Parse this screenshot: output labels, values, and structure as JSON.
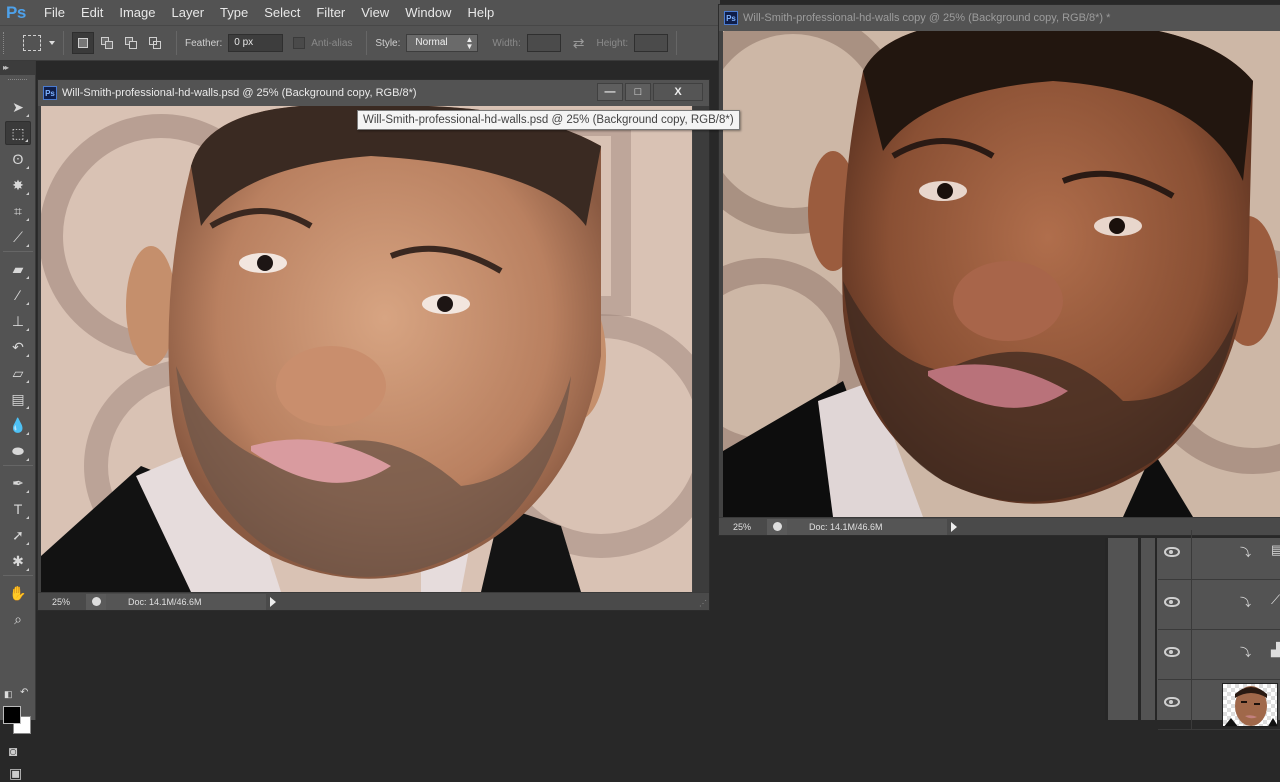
{
  "app": {
    "logo": "Ps",
    "brand_color": "#4ea1ea"
  },
  "menu": [
    "File",
    "Edit",
    "Image",
    "Layer",
    "Type",
    "Select",
    "Filter",
    "View",
    "Window",
    "Help"
  ],
  "options_bar": {
    "tool_icon": "rectangular-marquee-icon",
    "selection_modes": [
      "new-selection",
      "add-to-selection",
      "subtract-from-selection",
      "intersect-with-selection"
    ],
    "active_mode": "new-selection",
    "feather_label": "Feather:",
    "feather_value": "0 px",
    "anti_alias_label": "Anti-alias",
    "anti_alias_checked": false,
    "style_label": "Style:",
    "style_value": "Normal",
    "width_label": "Width:",
    "width_value": "",
    "height_label": "Height:",
    "height_value": ""
  },
  "tools_panel": {
    "collapse_label": "▸▸",
    "tools": [
      {
        "name": "move-tool",
        "glyph": "➤"
      },
      {
        "name": "rectangular-marquee-tool",
        "glyph": "⬚",
        "active": true
      },
      {
        "name": "lasso-tool",
        "glyph": "ʘ"
      },
      {
        "name": "magic-wand-tool",
        "glyph": "✸"
      },
      {
        "name": "crop-tool",
        "glyph": "⌗"
      },
      {
        "name": "eyedropper-tool",
        "glyph": "⟋"
      },
      {
        "name": "healing-brush-tool",
        "glyph": "▰"
      },
      {
        "name": "brush-tool",
        "glyph": "∕"
      },
      {
        "name": "clone-stamp-tool",
        "glyph": "⊥"
      },
      {
        "name": "history-brush-tool",
        "glyph": "↶"
      },
      {
        "name": "eraser-tool",
        "glyph": "▱"
      },
      {
        "name": "gradient-tool",
        "glyph": "▤"
      },
      {
        "name": "blur-tool",
        "glyph": "💧"
      },
      {
        "name": "dodge-tool",
        "glyph": "⬬"
      },
      {
        "name": "pen-tool",
        "glyph": "✒"
      },
      {
        "name": "type-tool",
        "glyph": "T"
      },
      {
        "name": "path-selection-tool",
        "glyph": "➚"
      },
      {
        "name": "custom-shape-tool",
        "glyph": "✱"
      },
      {
        "name": "hand-tool",
        "glyph": "✋"
      },
      {
        "name": "zoom-tool",
        "glyph": "⌕"
      }
    ],
    "foreground_color": "#000000",
    "background_color": "#ffffff",
    "quick_mask_glyph": "◙",
    "screen_mode_glyph": "▣"
  },
  "documents": [
    {
      "title": "Will-Smith-professional-hd-walls.psd @ 25% (Background copy, RGB/8*)",
      "active": true,
      "zoom": "25%",
      "doc_info": "Doc: 14.1M/46.6M",
      "window_buttons": {
        "minimize": "—",
        "maximize": "□",
        "close": "X"
      }
    },
    {
      "title": "Will-Smith-professional-hd-walls copy @ 25% (Background copy, RGB/8*) *",
      "active": false,
      "zoom": "25%",
      "doc_info": "Doc: 14.1M/46.6M"
    }
  ],
  "tooltip": "Will-Smith-professional-hd-walls.psd @ 25% (Background copy, RGB/8*)",
  "layers": [
    {
      "type": "adjustment",
      "adjustment_icon": "gradient-map-icon",
      "clipped": true,
      "visible": true
    },
    {
      "type": "adjustment",
      "adjustment_icon": "curves-icon",
      "clipped": true,
      "visible": true
    },
    {
      "type": "adjustment",
      "adjustment_icon": "levels-icon",
      "clipped": true,
      "visible": true
    },
    {
      "type": "pixel",
      "thumbnail": "portrait-thumbnail",
      "visible": true
    }
  ],
  "clip_glyph": "⤵"
}
